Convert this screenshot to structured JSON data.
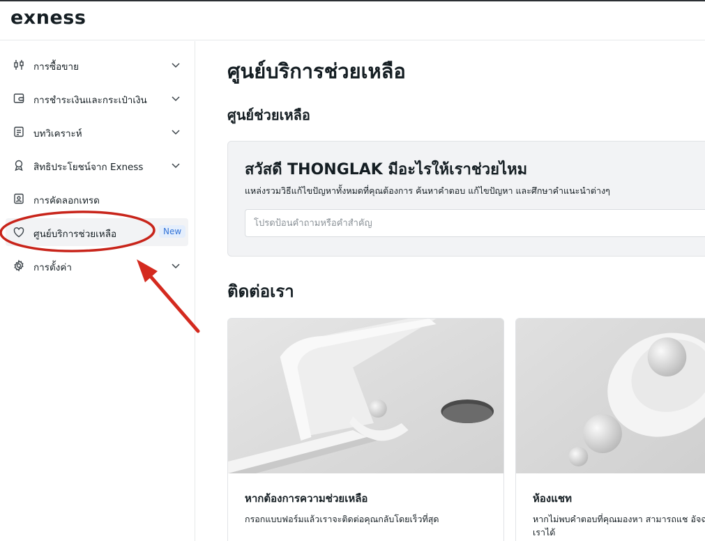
{
  "header": {
    "logo": "exness"
  },
  "sidebar": {
    "items": [
      {
        "label": "การซื้อขาย",
        "icon": "candlestick-icon"
      },
      {
        "label": "การชำระเงินและกระเป๋าเงิน",
        "icon": "wallet-icon"
      },
      {
        "label": "บทวิเคราะห์",
        "icon": "analytics-icon"
      },
      {
        "label": "สิทธิประโยชน์จาก Exness",
        "icon": "award-icon"
      },
      {
        "label": "การคัดลอกเทรด",
        "icon": "copy-trade-icon"
      },
      {
        "label": "ศูนย์บริการช่วยเหลือ",
        "icon": "heart-icon",
        "badge": "New",
        "active": true
      },
      {
        "label": "การตั้งค่า",
        "icon": "gear-icon"
      }
    ]
  },
  "main": {
    "page_title": "ศูนย์บริการช่วยเหลือ",
    "help_section_title": "ศูนย์ช่วยเหลือ",
    "greeting": "สวัสดี THONGLAK มีอะไรให้เราช่วยไหม",
    "help_subtitle": "แหล่งรวมวิธีแก้ไขปัญหาทั้งหมดที่คุณต้องการ ค้นหาคำตอบ แก้ไขปัญหา และศึกษาคำแนะนำต่างๆ",
    "search_placeholder": "โปรดป้อนคำถามหรือคำสำคัญ",
    "contact_title": "ติดต่อเรา",
    "cards": [
      {
        "title": "หากต้องการความช่วยเหลือ",
        "description": "กรอกแบบฟอร์มแล้วเราจะติดต่อคุณกลับโดยเร็วที่สุด"
      },
      {
        "title": "ห้องแชท",
        "description": "หากไม่พบคำตอบที่คุณมองหา สามารถแช อัจฉริยะของเราได้"
      }
    ]
  },
  "colors": {
    "accent_red": "#d42a1f",
    "badge_blue": "#3474d8"
  }
}
